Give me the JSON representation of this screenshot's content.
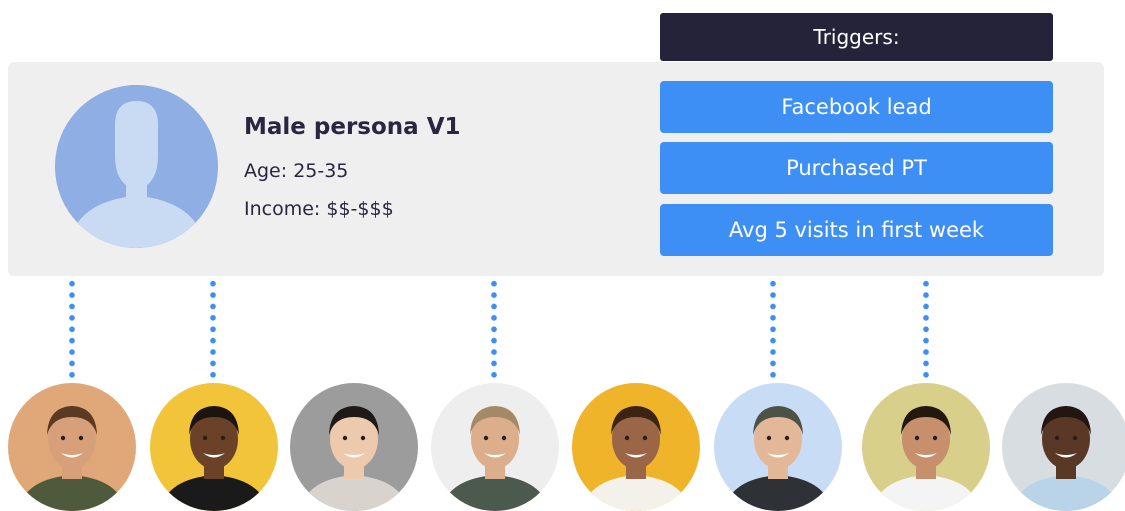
{
  "persona": {
    "name": "Male persona V1",
    "age": "Age: 25-35",
    "income": "Income: $$-$$$"
  },
  "triggers": {
    "header": "Triggers:",
    "items": [
      "Facebook lead",
      "Purchased PT",
      "Avg 5 visits in first week"
    ]
  },
  "colors": {
    "accent": "#3d8ef5",
    "header_bg": "#25233a",
    "card_bg": "#efefef",
    "text": "#2a2640"
  },
  "people": [
    {
      "icon": "person-photo-icon",
      "bg": "#e0a878",
      "skin": "#d8a07a",
      "hair": "#5a3a22",
      "shirt": "#4f5a3c"
    },
    {
      "icon": "person-photo-icon",
      "bg": "#f2c43a",
      "skin": "#6b4128",
      "hair": "#1c1410",
      "shirt": "#1a1a1a"
    },
    {
      "icon": "person-photo-icon",
      "bg": "#9c9c9c",
      "skin": "#edc9ae",
      "hair": "#1f1a18",
      "shirt": "#d8d3cc"
    },
    {
      "icon": "person-photo-icon",
      "bg": "#eeeeee",
      "skin": "#dcae8c",
      "hair": "#a58866",
      "shirt": "#4c5a4e"
    },
    {
      "icon": "person-photo-icon",
      "bg": "#f0b42a",
      "skin": "#9b6547",
      "hair": "#3b2416",
      "shirt": "#f4f0ea"
    },
    {
      "icon": "person-photo-icon",
      "bg": "#c8dcf5",
      "skin": "#e3b899",
      "hair": "#4c5246",
      "shirt": "#2e3236"
    },
    {
      "icon": "person-photo-icon",
      "bg": "#d7cf8a",
      "skin": "#c78f6b",
      "hair": "#221810",
      "shirt": "#f4f4f4"
    },
    {
      "icon": "person-photo-icon",
      "bg": "#d8dde2",
      "skin": "#5a3826",
      "hair": "#231610",
      "shirt": "#b9d3e8"
    }
  ]
}
